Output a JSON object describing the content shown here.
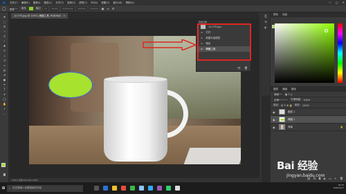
{
  "menubar": {
    "logo": "Ps",
    "items": [
      "文件(F)",
      "编辑(E)",
      "图像(I)",
      "图层(L)",
      "文字(Y)",
      "选择(S)",
      "滤镜(T)",
      "3D(D)",
      "视图(V)",
      "窗口(W)",
      "帮助(H)"
    ],
    "window_controls": [
      "—",
      "□",
      "✕"
    ]
  },
  "options": {
    "shape_label": "形状",
    "fill_label": "填充",
    "stroke_label": "描边",
    "fill_color": "#9fe02c"
  },
  "document": {
    "tab_title": "1c17f3.jpg @ 100% (椭圆工具, RGB/8#)",
    "tab_close": "×"
  },
  "canvas": {
    "ellipse_color": "#a6e22e"
  },
  "status": {
    "text": "100%  文档:593.4K/1.56M"
  },
  "history_panel": {
    "title": "历史记录",
    "snapshot_label": "1c17f3.jpg",
    "items": [
      {
        "label": "打开",
        "selected": false
      },
      {
        "label": "新建矢量图层",
        "selected": false
      },
      {
        "label": "路径",
        "selected": false
      },
      {
        "label": "椭圆工具",
        "selected": true
      }
    ],
    "footer_icons": [
      "📷",
      "🗑"
    ]
  },
  "color_panel": {
    "tabs": [
      "颜色",
      "色板"
    ],
    "foreground": "#9fe02c"
  },
  "layers_panel": {
    "tabs": [
      "图层",
      "通道",
      "路径"
    ],
    "kind_label": "类型",
    "blend_mode": "正常",
    "opacity_label": "不透明度:",
    "opacity_value": "100%",
    "lock_label": "锁定:",
    "fill_label": "填充:",
    "fill_value": "100%",
    "layers": [
      {
        "name": "图层 1",
        "thumb": "blank",
        "selected": false
      },
      {
        "name": "椭圆 1",
        "thumb": "ellipse",
        "selected": true
      },
      {
        "name": "背景",
        "thumb": "photo",
        "selected": false
      }
    ]
  },
  "taskbar": {
    "search_placeholder": "在这里输入你要搜索的内容",
    "time": "18:35",
    "date": "2020/4/27",
    "app_colors": [
      "#2f6fd6",
      "#f2c12e",
      "#e84c3d",
      "#3bb54a",
      "#8ac6ff",
      "#31a8ff",
      "#9b59b6",
      "#2ecc71",
      "#ffffff"
    ]
  },
  "watermark": {
    "brand": "Bai 经验",
    "url": "jingyan.baidu.com"
  }
}
